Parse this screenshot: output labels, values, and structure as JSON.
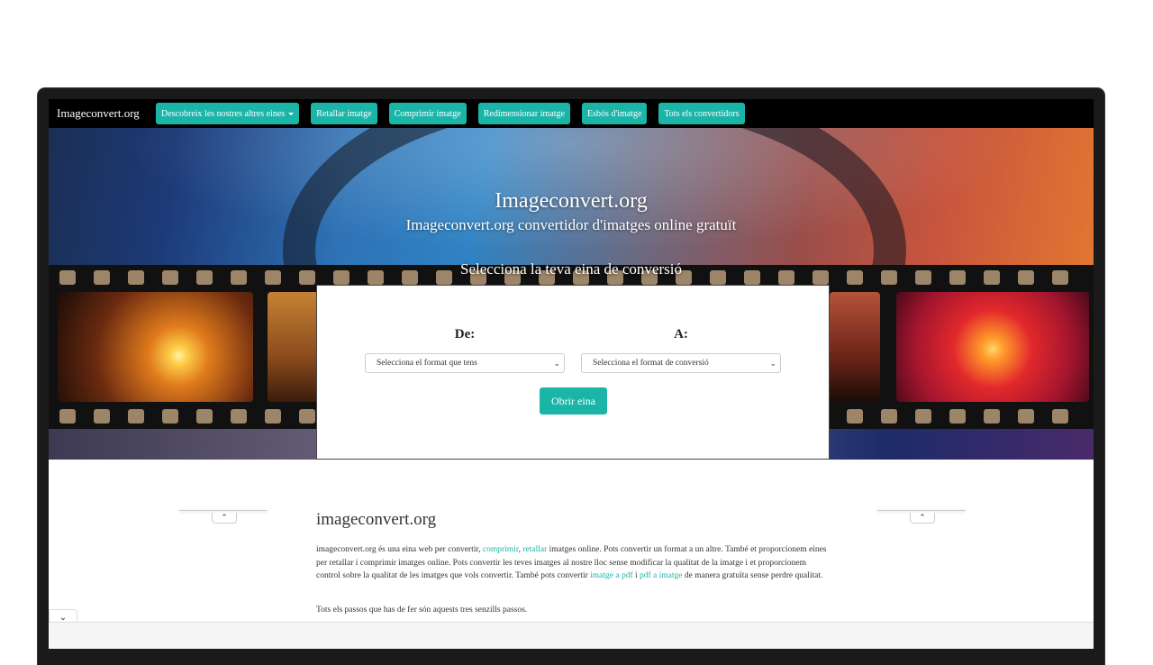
{
  "navbar": {
    "brand": "Imageconvert.org",
    "items": [
      {
        "label": "Descobreix les nostres altres eines",
        "dropdown": true
      },
      {
        "label": "Retallar imatge"
      },
      {
        "label": "Comprimir imatge"
      },
      {
        "label": "Redimensionar imatge"
      },
      {
        "label": "Esbós d'imatge"
      },
      {
        "label": "Tots els convertidors"
      }
    ]
  },
  "hero": {
    "title": "Imageconvert.org",
    "subtitle": "Imageconvert.org convertidor d'imatges online gratuït",
    "select_prompt": "Selecciona la teva eina de conversió"
  },
  "converter": {
    "from_label": "De:",
    "to_label": "A:",
    "from_placeholder": "Selecciona el format que tens",
    "to_placeholder": "Selecciona el format de conversió",
    "open_button": "Obrir eina"
  },
  "content": {
    "title": "imageconvert.org",
    "para_1": "imageconvert.org és una eina web per convertir, ",
    "link_compress": "comprimir",
    "para_2": ", ",
    "link_crop": "retallar",
    "para_3": " imatges online. Pots convertir un format a un altre. També et proporcionem eines per retallar i comprimir imatges online. Pots convertir les teves imatges al nostre lloc sense modificar la qualitat de la imatge i et proporcionem control sobre la qualitat de les imatges que vols convertir. També pots convertir ",
    "link_img_pdf": "imatge a pdf",
    "para_4": " i ",
    "link_pdf_img": "pdf a imatge",
    "para_5": " de manera gratuïta sense perdre qualitat.",
    "steps": "Tots els passos que has de fer són aquests tres senzills passos."
  },
  "colors": {
    "accent": "#1bb5a8",
    "navbar_bg": "#000000"
  },
  "icons": {
    "dropdown": "caret-down-icon",
    "collapse_left": "chevron-up-icon",
    "collapse_right": "chevron-up-icon",
    "bottom_toggle": "chevron-down-icon"
  }
}
